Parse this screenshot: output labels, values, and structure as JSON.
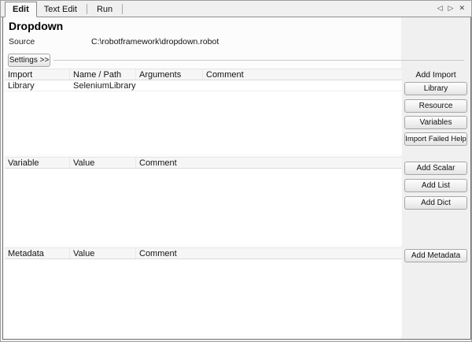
{
  "tabs": [
    {
      "label": "Edit",
      "active": true
    },
    {
      "label": "Text Edit",
      "active": false
    },
    {
      "label": "Run",
      "active": false
    }
  ],
  "icons": {
    "scroll_left": "◁",
    "scroll_right": "▷",
    "close": "✕"
  },
  "header": {
    "title": "Dropdown",
    "source_label": "Source",
    "source_value": "C:\\robotframework\\dropdown.robot"
  },
  "settings": {
    "toggle_label": "Settings >>"
  },
  "import_table": {
    "headers": [
      "Import",
      "Name / Path",
      "Arguments",
      "Comment"
    ],
    "rows": [
      [
        "Library",
        "SeleniumLibrary",
        "",
        ""
      ]
    ]
  },
  "import_actions": {
    "label": "Add Import",
    "buttons": [
      "Library",
      "Resource",
      "Variables",
      "Import Failed Help"
    ]
  },
  "variable_table": {
    "headers": [
      "Variable",
      "Value",
      "Comment"
    ],
    "rows": []
  },
  "variable_actions": {
    "buttons": [
      "Add Scalar",
      "Add List",
      "Add Dict"
    ]
  },
  "metadata_table": {
    "headers": [
      "Metadata",
      "Value",
      "Comment"
    ],
    "rows": []
  },
  "metadata_actions": {
    "buttons": [
      "Add Metadata"
    ]
  },
  "colors": {
    "panel_bg": "#f0f0f0",
    "panel_border": "#6f6f6f",
    "table_bg": "#ffffff"
  }
}
